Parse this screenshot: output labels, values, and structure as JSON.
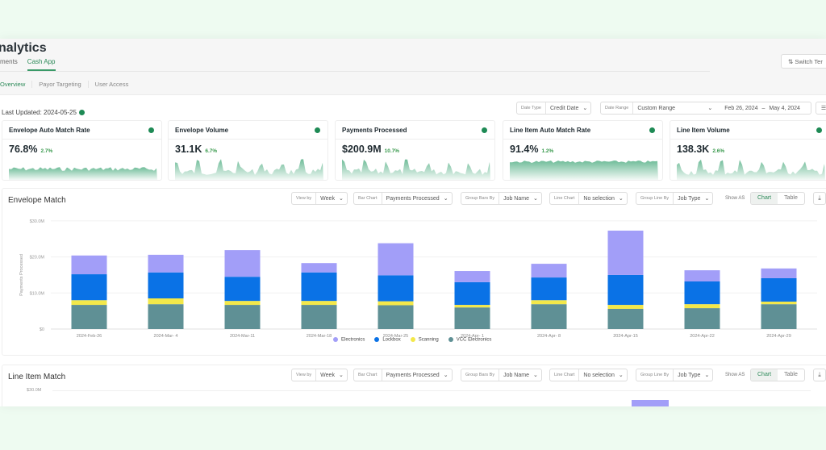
{
  "header": {
    "title": "nalytics",
    "tabs": [
      {
        "label": "ments"
      },
      {
        "label": "Cash App",
        "active": true
      }
    ],
    "switch_label": "⇅ Switch Ter"
  },
  "subtabs": [
    {
      "label": "Overview"
    },
    {
      "label": "Payor Targeting"
    },
    {
      "label": "User Access"
    }
  ],
  "last_updated": "Last Updated: 2024-05-25",
  "filters": {
    "date_type_key": "Date Type",
    "date_type": "Credit Date",
    "date_range_key": "Date Range",
    "date_range": "Custom Range",
    "start": "Feb 26, 2024",
    "dash": "–",
    "end": "May 4, 2024"
  },
  "kpis": [
    {
      "title": "Envelope Auto Match Rate",
      "value": "76.8%",
      "change": "2.7%"
    },
    {
      "title": "Envelope Volume",
      "value": "31.1K",
      "change": "6.7%"
    },
    {
      "title": "Payments Processed",
      "value": "$200.9M",
      "change": "10.7%"
    },
    {
      "title": "Line Item Auto Match Rate",
      "value": "91.4%",
      "change": "1.2%"
    },
    {
      "title": "Line Item Volume",
      "value": "138.3K",
      "change": "2.6%"
    }
  ],
  "controls": {
    "view_by_key": "View by",
    "view_by": "Week",
    "bar_chart_key": "Bar Chart",
    "bar_chart": "Payments Processed",
    "group_bars_key": "Group Bars By",
    "group_bars": "Job Name",
    "line_chart_key": "Line Chart",
    "line_chart": "No selection",
    "group_line_key": "Group Line By",
    "group_line": "Job Type",
    "show_as": "Show AS",
    "chart": "Chart",
    "table": "Table"
  },
  "envelope_title": "Envelope Match",
  "line_item_title": "Line Item Match",
  "line_item_tick": "$30.0M",
  "colors": {
    "accent": "#2e8b5a",
    "Electronics": "#a29ef8",
    "Lockbox": "#0a72e6",
    "Scanning": "#f3e84a",
    "VCC Electronics": "#5f9095"
  },
  "chart_data": {
    "type": "bar",
    "stacked": true,
    "ylabel": "Payments Processed",
    "ylim": [
      0,
      30
    ],
    "yunit": "$M",
    "yticks": [
      "$0",
      "$10.0M",
      "$20.0M",
      "$30.0M"
    ],
    "categories": [
      "2024-Feb-26",
      "2024-Mar- 4",
      "2024-Mar-11",
      "2024-Mar-18",
      "2024-Mar-25",
      "2024-Apr- 1",
      "2024-Apr- 8",
      "2024-Apr-15",
      "2024-Apr-22",
      "2024-Apr-29"
    ],
    "series": [
      {
        "name": "VCC Electronics",
        "values": [
          6.7,
          6.9,
          6.7,
          6.7,
          6.6,
          6.0,
          6.9,
          5.6,
          5.8,
          6.9
        ]
      },
      {
        "name": "Scanning",
        "values": [
          1.3,
          1.6,
          1.1,
          1.1,
          1.1,
          0.7,
          1.1,
          1.1,
          1.1,
          0.7
        ]
      },
      {
        "name": "Lockbox",
        "values": [
          7.2,
          7.2,
          6.7,
          7.9,
          7.2,
          6.3,
          6.3,
          8.3,
          6.3,
          6.5
        ]
      },
      {
        "name": "Electronics",
        "values": [
          5.2,
          4.9,
          7.4,
          2.6,
          8.9,
          3.1,
          3.8,
          12.3,
          3.1,
          2.7
        ]
      }
    ],
    "legend": [
      "Electronics",
      "Lockbox",
      "Scanning",
      "VCC Electronics"
    ],
    "legend_position": "bottom",
    "grid": true
  }
}
